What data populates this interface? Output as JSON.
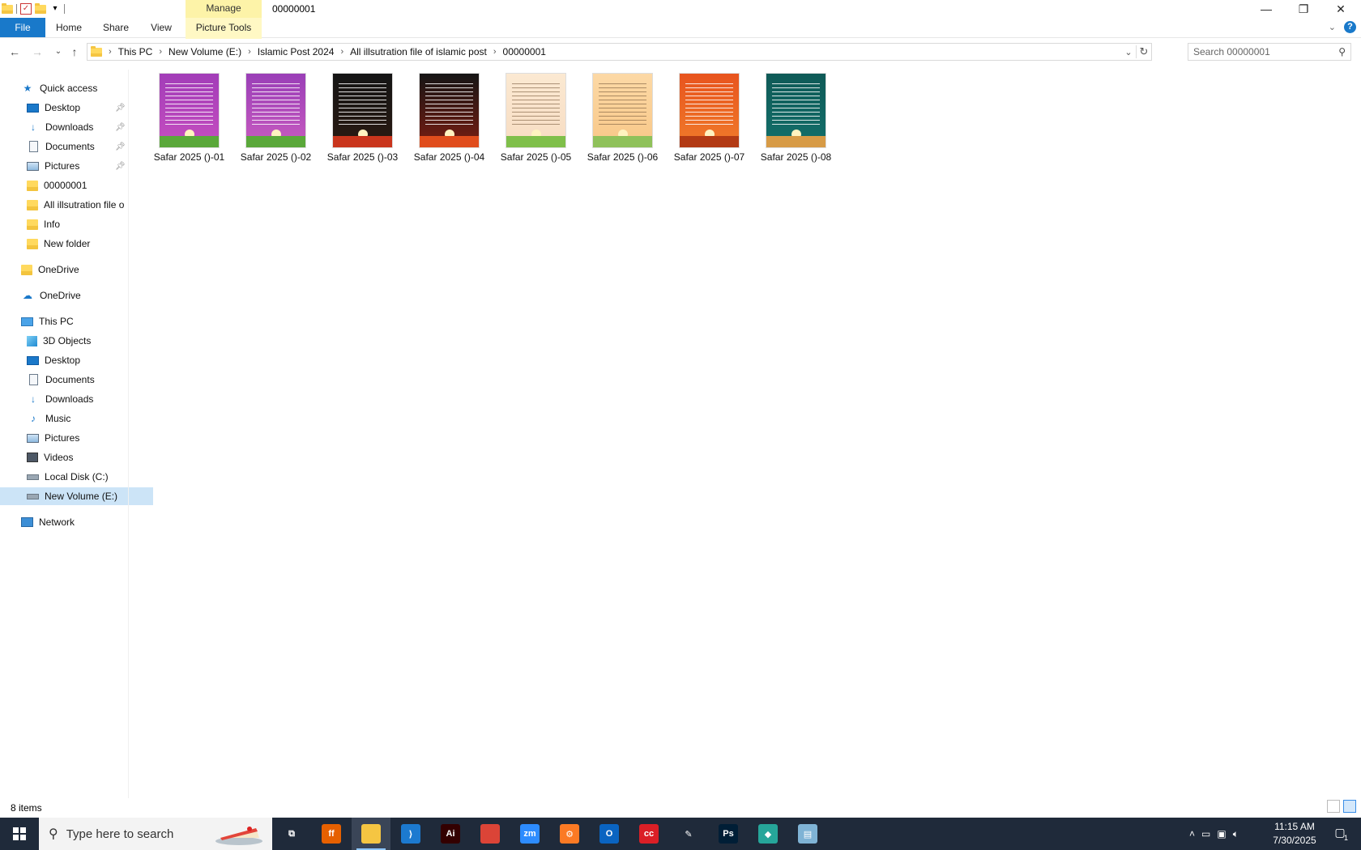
{
  "window": {
    "title": "00000001",
    "manage_label": "Manage",
    "minimize": "—",
    "restore": "❐",
    "close": "✕"
  },
  "ribbon": {
    "tabs": [
      {
        "label": "File"
      },
      {
        "label": "Home"
      },
      {
        "label": "Share"
      },
      {
        "label": "View"
      },
      {
        "label": "Picture Tools"
      }
    ],
    "help": "?"
  },
  "address": {
    "crumbs": [
      "This PC",
      "New Volume (E:)",
      "Islamic Post 2024",
      "All illsutration file of islamic post",
      "00000001"
    ],
    "search_placeholder": "Search 00000001"
  },
  "sidebar": {
    "quick_access": "Quick access",
    "quick_items": [
      "Desktop",
      "Downloads",
      "Documents",
      "Pictures",
      "00000001",
      "All illsutration file o",
      "Info",
      "New folder"
    ],
    "onedrive_personal": "OneDrive",
    "onedrive": "OneDrive",
    "this_pc": "This PC",
    "pc_items": [
      "3D Objects",
      "Desktop",
      "Documents",
      "Downloads",
      "Music",
      "Pictures",
      "Videos",
      "Local Disk (C:)",
      "New Volume (E:)"
    ],
    "network": "Network"
  },
  "files": [
    {
      "name": "Safar 2025 ()-01",
      "top": "#a23db8",
      "bottom": "#c64ec0",
      "hill": "#5aa83a",
      "style": "light"
    },
    {
      "name": "Safar 2025 ()-02",
      "top": "#9a3fb7",
      "bottom": "#c85bc0",
      "hill": "#5aa83a",
      "style": "light"
    },
    {
      "name": "Safar 2025 ()-03",
      "top": "#151515",
      "bottom": "#2a1a12",
      "hill": "#c9351c",
      "style": "light"
    },
    {
      "name": "Safar 2025 ()-04",
      "top": "#151515",
      "bottom": "#7a1d12",
      "hill": "#e04d1c",
      "style": "light"
    },
    {
      "name": "Safar 2025 ()-05",
      "top": "#fbe9d2",
      "bottom": "#f7dcc2",
      "hill": "#7fbf4a",
      "style": "dark"
    },
    {
      "name": "Safar 2025 ()-06",
      "top": "#fcd9a6",
      "bottom": "#f8c787",
      "hill": "#8fc15a",
      "style": "dark"
    },
    {
      "name": "Safar 2025 ()-07",
      "top": "#e8541e",
      "bottom": "#f07b2a",
      "hill": "#b23a14",
      "style": "light"
    },
    {
      "name": "Safar 2025 ()-08",
      "top": "#0f5a57",
      "bottom": "#13706b",
      "hill": "#d79b46",
      "style": "light"
    }
  ],
  "status": {
    "items_count": "8 items"
  },
  "taskbar": {
    "search_placeholder": "Type here to search",
    "apps": [
      {
        "name": "task-view",
        "label": "⧉",
        "color": "#1f2a3a"
      },
      {
        "name": "firefox",
        "label": "ff",
        "color": "#e66000"
      },
      {
        "name": "file-explorer",
        "label": "",
        "color": "#f5c542"
      },
      {
        "name": "vscode",
        "label": "⟩",
        "color": "#1c7ad0"
      },
      {
        "name": "illustrator",
        "label": "Ai",
        "color": "#330000"
      },
      {
        "name": "chrome",
        "label": "",
        "color": "#db4437"
      },
      {
        "name": "zoom",
        "label": "zm",
        "color": "#2d8cff"
      },
      {
        "name": "xampp",
        "label": "⚙",
        "color": "#fb7a24"
      },
      {
        "name": "outlook",
        "label": "O",
        "color": "#0a64c1"
      },
      {
        "name": "creative-cloud",
        "label": "cc",
        "color": "#da1f26"
      },
      {
        "name": "pen-tool",
        "label": "✎",
        "color": "#1f2a3a"
      },
      {
        "name": "photoshop",
        "label": "Ps",
        "color": "#001e36"
      },
      {
        "name": "app-blue",
        "label": "◆",
        "color": "#26a69a"
      },
      {
        "name": "app-notes",
        "label": "▤",
        "color": "#7fb3d5"
      }
    ],
    "time": "11:15 AM",
    "date": "7/30/2025",
    "notif_count": "1"
  }
}
